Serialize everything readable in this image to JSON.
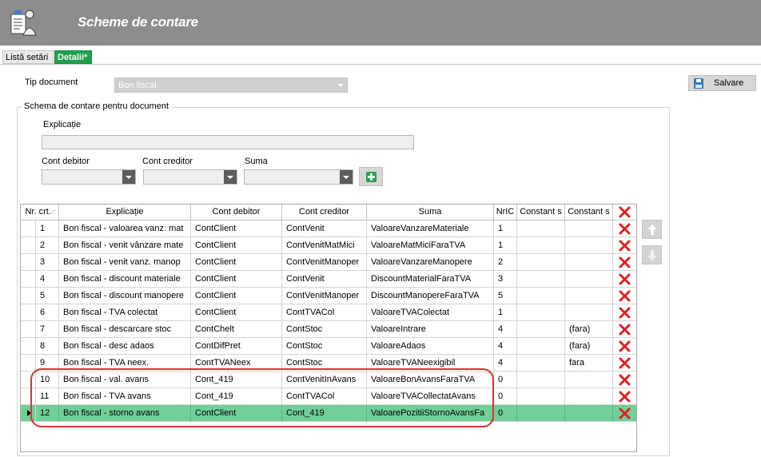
{
  "header": {
    "title": "Scheme de contare"
  },
  "tabs": [
    {
      "label": "Listă setări"
    },
    {
      "label": "Detalii*"
    }
  ],
  "form": {
    "doc_type_label": "Tip document",
    "doc_type_value": "Bon fiscal",
    "group_title": "Schema de contare pentru document",
    "explanation_label": "Explicație",
    "debit_label": "Cont debitor",
    "credit_label": "Cont creditor",
    "sum_label": "Suma",
    "save_label": "Salvare"
  },
  "grid": {
    "columns": [
      "Nr. crt.",
      "Explicație",
      "Cont debitor",
      "Cont creditor",
      "Suma",
      "NrIC",
      "Constant s",
      "Constant s"
    ],
    "rows": [
      {
        "nr": "1",
        "explicatie": "Bon fiscal - valoarea vanz. mat",
        "debit": "ContClient",
        "credit": "ContVenit",
        "suma": "ValoareVanzareMateriale",
        "nric": "1",
        "c1": "",
        "c2": ""
      },
      {
        "nr": "2",
        "explicatie": "Bon fiscal - venit vânzare mate",
        "debit": "ContClient",
        "credit": "ContVenitMatMici",
        "suma": "ValoareMatMiciFaraTVA",
        "nric": "1",
        "c1": "",
        "c2": ""
      },
      {
        "nr": "3",
        "explicatie": "Bon fiscal - venit vanz. manop",
        "debit": "ContClient",
        "credit": "ContVenitManoper",
        "suma": "ValoareVanzareManopere",
        "nric": "2",
        "c1": "",
        "c2": ""
      },
      {
        "nr": "4",
        "explicatie": "Bon fiscal - discount materiale",
        "debit": "ContClient",
        "credit": "ContVenit",
        "suma": "DiscountMaterialFaraTVA",
        "nric": "3",
        "c1": "",
        "c2": ""
      },
      {
        "nr": "5",
        "explicatie": "Bon fiscal - discount manopere",
        "debit": "ContClient",
        "credit": "ContVenitManoper",
        "suma": "DiscountManopereFaraTVA",
        "nric": "5",
        "c1": "",
        "c2": ""
      },
      {
        "nr": "6",
        "explicatie": "Bon fiscal - TVA colectat",
        "debit": "ContClient",
        "credit": "ContTVACol",
        "suma": "ValoareTVAColectat",
        "nric": "1",
        "c1": "",
        "c2": ""
      },
      {
        "nr": "7",
        "explicatie": "Bon fiscal - descarcare stoc",
        "debit": "ContChelt",
        "credit": "ContStoc",
        "suma": "ValoareIntrare",
        "nric": "4",
        "c1": "",
        "c2": "(fara)"
      },
      {
        "nr": "8",
        "explicatie": "Bon fiscal - desc adaos",
        "debit": "ContDifPret",
        "credit": "ContStoc",
        "suma": "ValoareAdaos",
        "nric": "4",
        "c1": "",
        "c2": "(fara)"
      },
      {
        "nr": "9",
        "explicatie": "Bon fiscal - TVA neex.",
        "debit": "ContTVANeex",
        "credit": "ContStoc",
        "suma": "ValoareTVANeexigibil",
        "nric": "4",
        "c1": "",
        "c2": "fara"
      },
      {
        "nr": "10",
        "explicatie": "Bon fiscal - val. avans",
        "debit": "Cont_419",
        "credit": "ContVenitInAvans",
        "suma": "ValoareBonAvansFaraTVA",
        "nric": "0",
        "c1": "",
        "c2": ""
      },
      {
        "nr": "11",
        "explicatie": "Bon fiscal - TVA avans",
        "debit": "Cont_419",
        "credit": "ContTVACol",
        "suma": "ValoareTVACollectatAvans",
        "nric": "0",
        "c1": "",
        "c2": ""
      },
      {
        "nr": "12",
        "explicatie": "Bon fiscal - storno avans",
        "debit": "ContClient",
        "credit": "Cont_419",
        "suma": "ValoarePozitiiStornoAvansFa",
        "nric": "0",
        "c1": "",
        "c2": ""
      }
    ]
  },
  "colors": {
    "header_bg": "#8d8d8d",
    "tab_active": "#1fa04a",
    "selected_row": "#6fcf97",
    "delete": "#e02020",
    "highlight": "#e03030"
  },
  "icons": {
    "app": "document-user-icon",
    "save": "floppy-disk-icon",
    "add": "plus-icon",
    "delete": "red-x-icon",
    "up": "arrow-up-icon",
    "down": "arrow-down-icon"
  }
}
